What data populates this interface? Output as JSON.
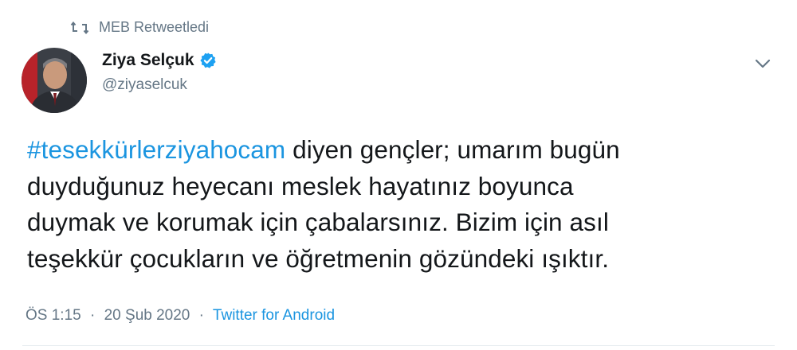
{
  "retweet": {
    "icon": "retweet-icon",
    "label": "MEB Retweetledi"
  },
  "author": {
    "avatar": "avatar-photo",
    "name": "Ziya Selçuk",
    "verified_icon": "verified-badge-icon",
    "handle": "@ziyaselcuk"
  },
  "menu": {
    "icon": "chevron-down-icon"
  },
  "tweet": {
    "hashtag": "#tesekkürlerziyahocam",
    "line1_rest": " diyen gençler; umarım bugün",
    "line2": "duyduğunuz heyecanı meslek hayatınız boyunca",
    "line3": "duymak ve korumak için çabalarsınız. Bizim için asıl",
    "line4": "teşekkür çocukların ve öğretmenin gözündeki ışıktır."
  },
  "meta": {
    "time": "ÖS 1:15",
    "separator1": "·",
    "date": "20 Şub 2020",
    "separator2": "·",
    "source": "Twitter for Android"
  },
  "colors": {
    "link": "#1b95e0",
    "muted": "#657786",
    "text": "#14171a",
    "divider": "#e6ecf0"
  }
}
